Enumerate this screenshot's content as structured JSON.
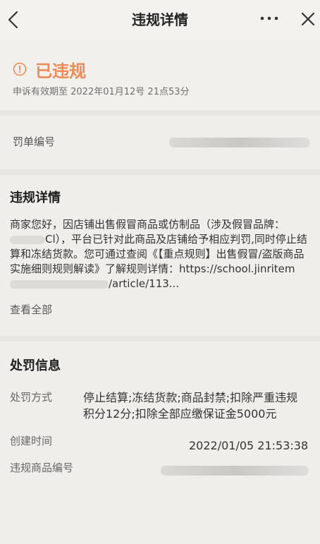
{
  "nav": {
    "title": "违规详情",
    "more_icon": "more-horizontal-icon",
    "back_icon": "chevron-left-icon",
    "close_icon": "close-icon"
  },
  "status": {
    "icon": "info-circle-icon",
    "text": "已违规",
    "appeal_deadline": "申诉有效期至 2022年01月12号 21点53分",
    "accent_color": "#f08a55"
  },
  "penalty_no": {
    "label": "罚单编号"
  },
  "violation_detail": {
    "title": "违规详情",
    "text_part1": "商家您好，因店铺出售假冒商品或仿制品（涉及假冒品牌：",
    "text_part2": "Cl），平台已针对此商品及店铺给予相应判罚,同时停止结算和冻结货款。您可通过查阅《【重点规则】出售假冒/盗版商品实施细则规则解读》了解规则详情：https://school.jinritem",
    "text_part3": "/article/113...",
    "see_all": "查看全部"
  },
  "penalty_info": {
    "title": "处罚信息",
    "method_label": "处罚方式",
    "method_value": "停止结算;冻结货款;商品封禁;扣除严重违规积分12分;扣除全部应缴保证金5000元",
    "created_label": "创建时间",
    "created_value": "2022/01/05 21:53:38",
    "item_no_label": "违规商品编号"
  }
}
